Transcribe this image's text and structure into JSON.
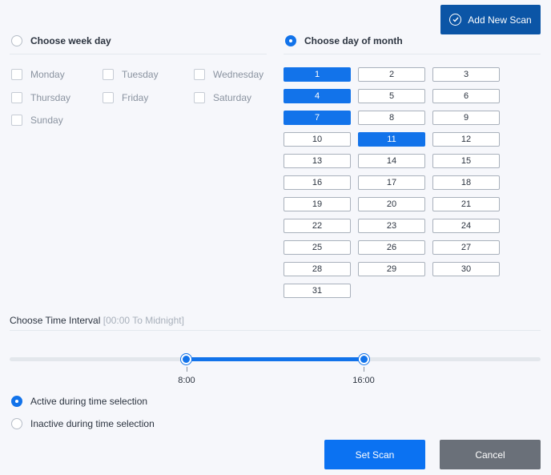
{
  "header": {
    "add_new_scan": "Add New Scan"
  },
  "weekday": {
    "label": "Choose week day",
    "selected": false,
    "days": [
      "Monday",
      "Tuesday",
      "Wednesday",
      "Thursday",
      "Friday",
      "Saturday",
      "Sunday"
    ]
  },
  "monthday": {
    "label": "Choose day of month",
    "selected": true,
    "days": [
      "1",
      "2",
      "3",
      "4",
      "5",
      "6",
      "7",
      "8",
      "9",
      "10",
      "11",
      "12",
      "13",
      "14",
      "15",
      "16",
      "17",
      "18",
      "19",
      "20",
      "21",
      "22",
      "23",
      "24",
      "25",
      "26",
      "27",
      "28",
      "29",
      "30",
      "31"
    ],
    "selected_days": [
      "1",
      "4",
      "7",
      "11"
    ]
  },
  "interval": {
    "title": "Choose Time Interval",
    "subtitle": "[00:00 To Midnight]",
    "start_label": "8:00",
    "end_label": "16:00",
    "start_fraction": 0.3333,
    "end_fraction": 0.6667
  },
  "mode": {
    "active_label": "Active during time selection",
    "inactive_label": "Inactive during time selection",
    "selected": "active"
  },
  "footer": {
    "set_scan": "Set Scan",
    "cancel": "Cancel"
  },
  "colors": {
    "accent": "#1273ea",
    "primary_dark": "#0b55a6",
    "cancel": "#6a7079"
  }
}
